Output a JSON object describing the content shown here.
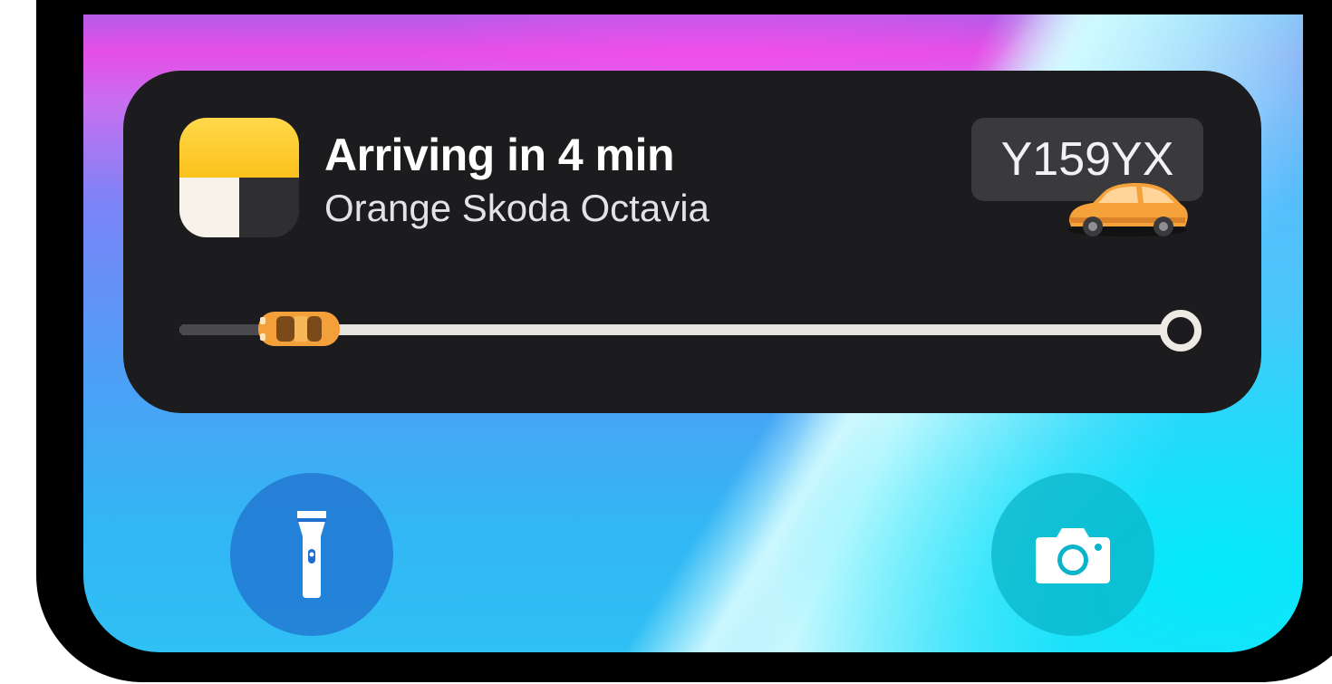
{
  "live_activity": {
    "title": "Arriving in 4 min",
    "subtitle": "Orange Skoda Octavia",
    "license_plate": "Y159YX",
    "app_icon": "taxi-app-icon",
    "car_icon": "orange-car-icon",
    "progress": 0.12,
    "destination_icon": "destination-ring-icon"
  },
  "lock_screen": {
    "left_action_icon": "flashlight-icon",
    "right_action_icon": "camera-icon"
  },
  "colors": {
    "card_background": "#1c1c1e",
    "plate_background": "#3a3a3c",
    "car_orange": "#f6a23a",
    "track": "#e6e4df",
    "app_icon_yellow": "#fcc21b"
  }
}
